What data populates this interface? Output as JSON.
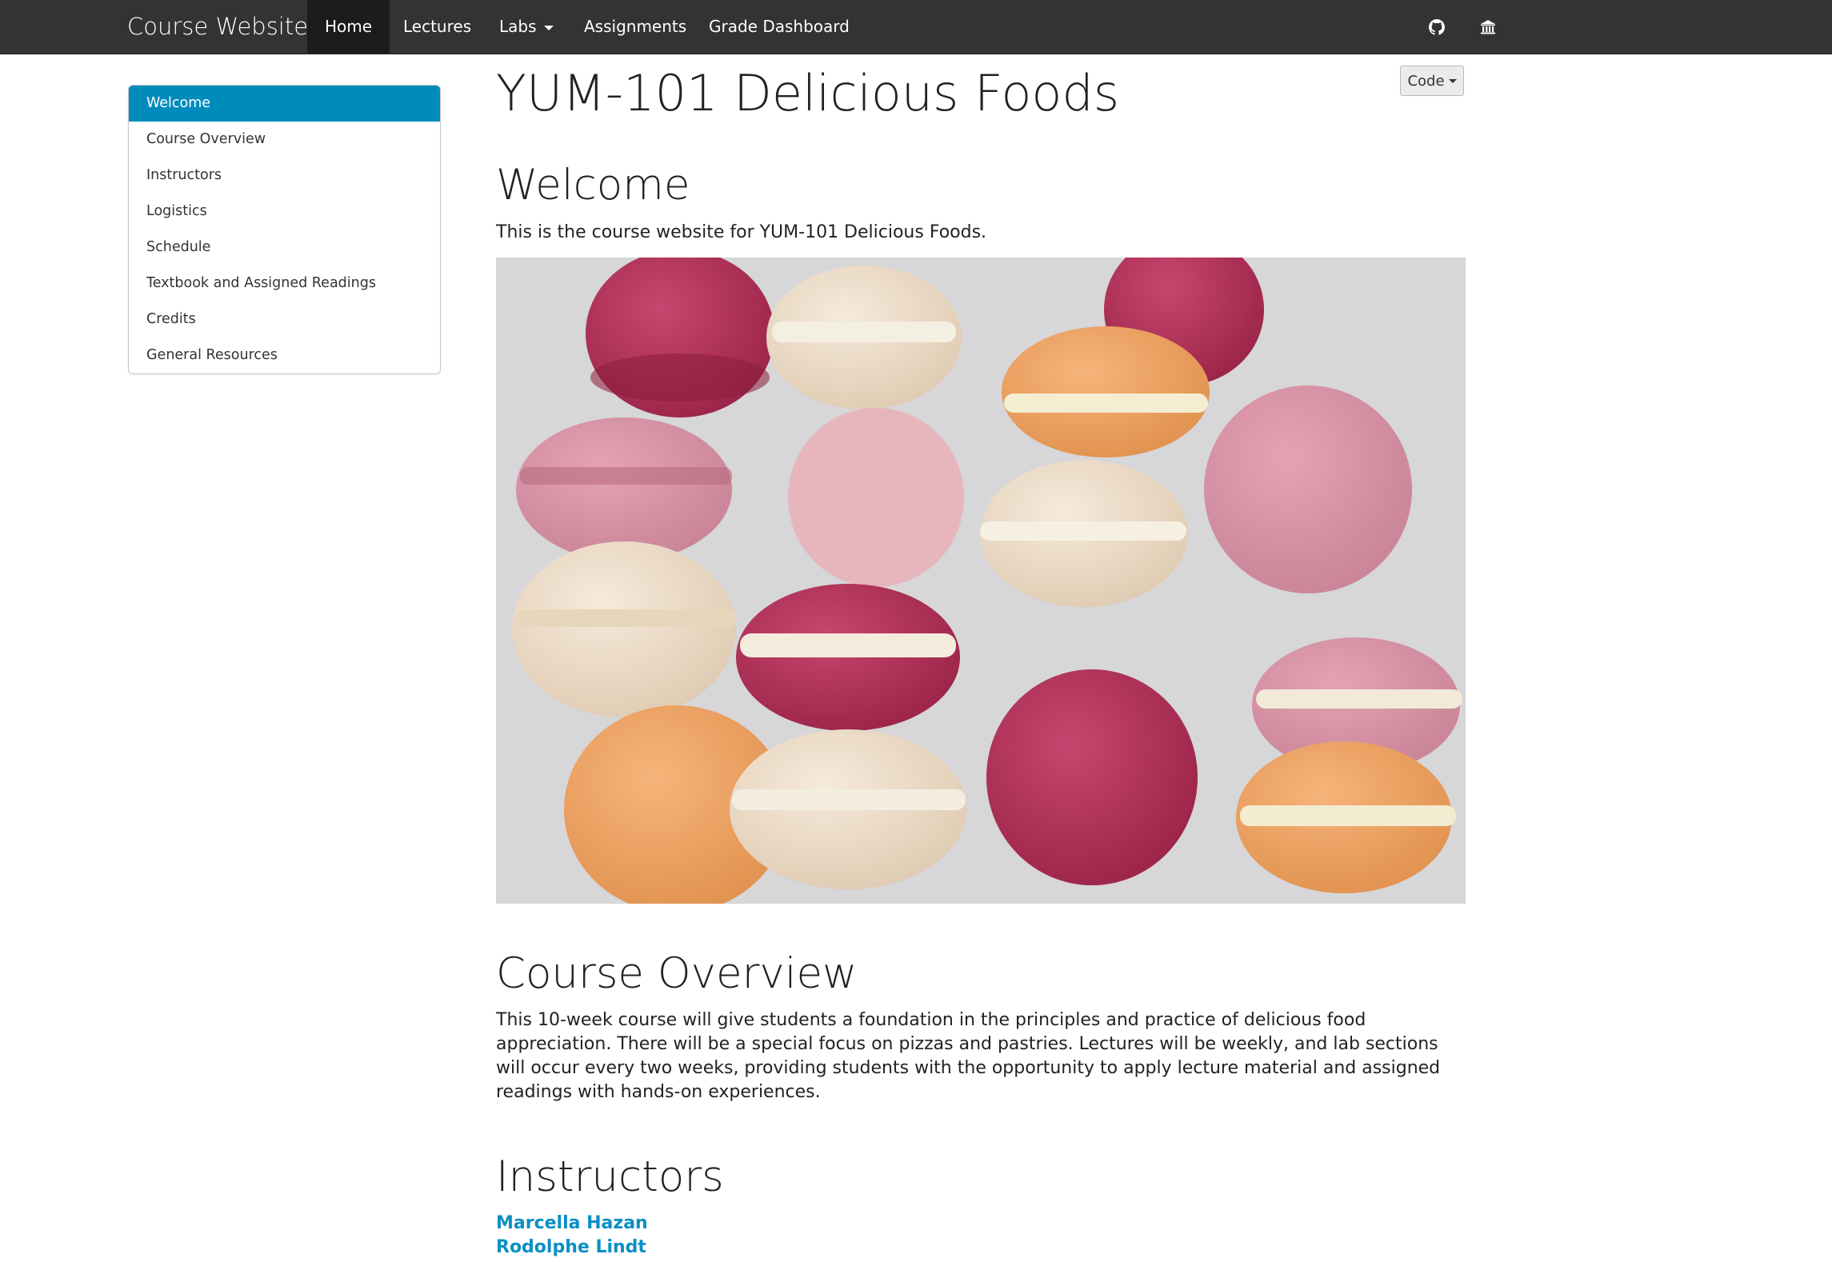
{
  "navbar": {
    "brand": "Course Website",
    "items": [
      {
        "label": "Home",
        "active": true
      },
      {
        "label": "Lectures"
      },
      {
        "label": "Labs",
        "dropdown": true
      },
      {
        "label": "Assignments"
      },
      {
        "label": "Grade Dashboard"
      }
    ],
    "icons": [
      "github-icon",
      "institution-icon"
    ]
  },
  "toc": {
    "items": [
      {
        "label": "Welcome",
        "active": true
      },
      {
        "label": "Course Overview"
      },
      {
        "label": "Instructors"
      },
      {
        "label": "Logistics"
      },
      {
        "label": "Schedule"
      },
      {
        "label": "Textbook and Assigned Readings"
      },
      {
        "label": "Credits"
      },
      {
        "label": "General Resources"
      }
    ]
  },
  "main": {
    "title": "YUM-101 Delicious Foods",
    "code_button": "Code",
    "welcome": {
      "heading": "Welcome",
      "text": "This is the course website for YUM-101 Delicious Foods.",
      "image": "macarons-photo"
    },
    "overview": {
      "heading": "Course Overview",
      "text": "This 10-week course will give students a foundation in the principles and practice of delicious food appreciation. There will be a special focus on pizzas and pastries. Lectures will be weekly, and lab sections will occur every two weeks, providing students with the opportunity to apply lecture material and assigned readings with hands-on experiences."
    },
    "instructors": {
      "heading": "Instructors",
      "names": [
        "Marcella Hazan",
        "Rodolphe Lindt"
      ]
    }
  },
  "colors": {
    "navbar_bg": "#333333",
    "active_nav_bg": "#1c1c1c",
    "toc_active": "#008bbd",
    "link": "#0a8fc4"
  }
}
